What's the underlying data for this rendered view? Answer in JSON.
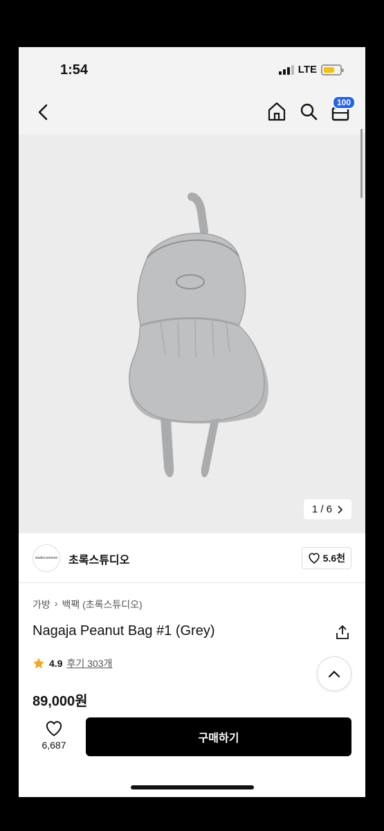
{
  "status_bar": {
    "time": "1:54",
    "network": "LTE"
  },
  "nav": {
    "cart_count": "100"
  },
  "gallery": {
    "counter": "1 / 6"
  },
  "brand": {
    "logo_text": "studiocommon",
    "name": "초록스튜디오",
    "likes": "5.6천"
  },
  "product": {
    "breadcrumb": [
      "가방",
      "백팩 (초록스튜디오)"
    ],
    "title": "Nagaja Peanut Bag #1 (Grey)",
    "rating": "4.9",
    "reviews": "후기 303개",
    "price": "89,000원"
  },
  "actions": {
    "wish_count": "6,687",
    "buy_label": "구매하기"
  },
  "colors": {
    "star": "#f5a623",
    "badge": "#2563eb",
    "battery": "#f5c400"
  }
}
